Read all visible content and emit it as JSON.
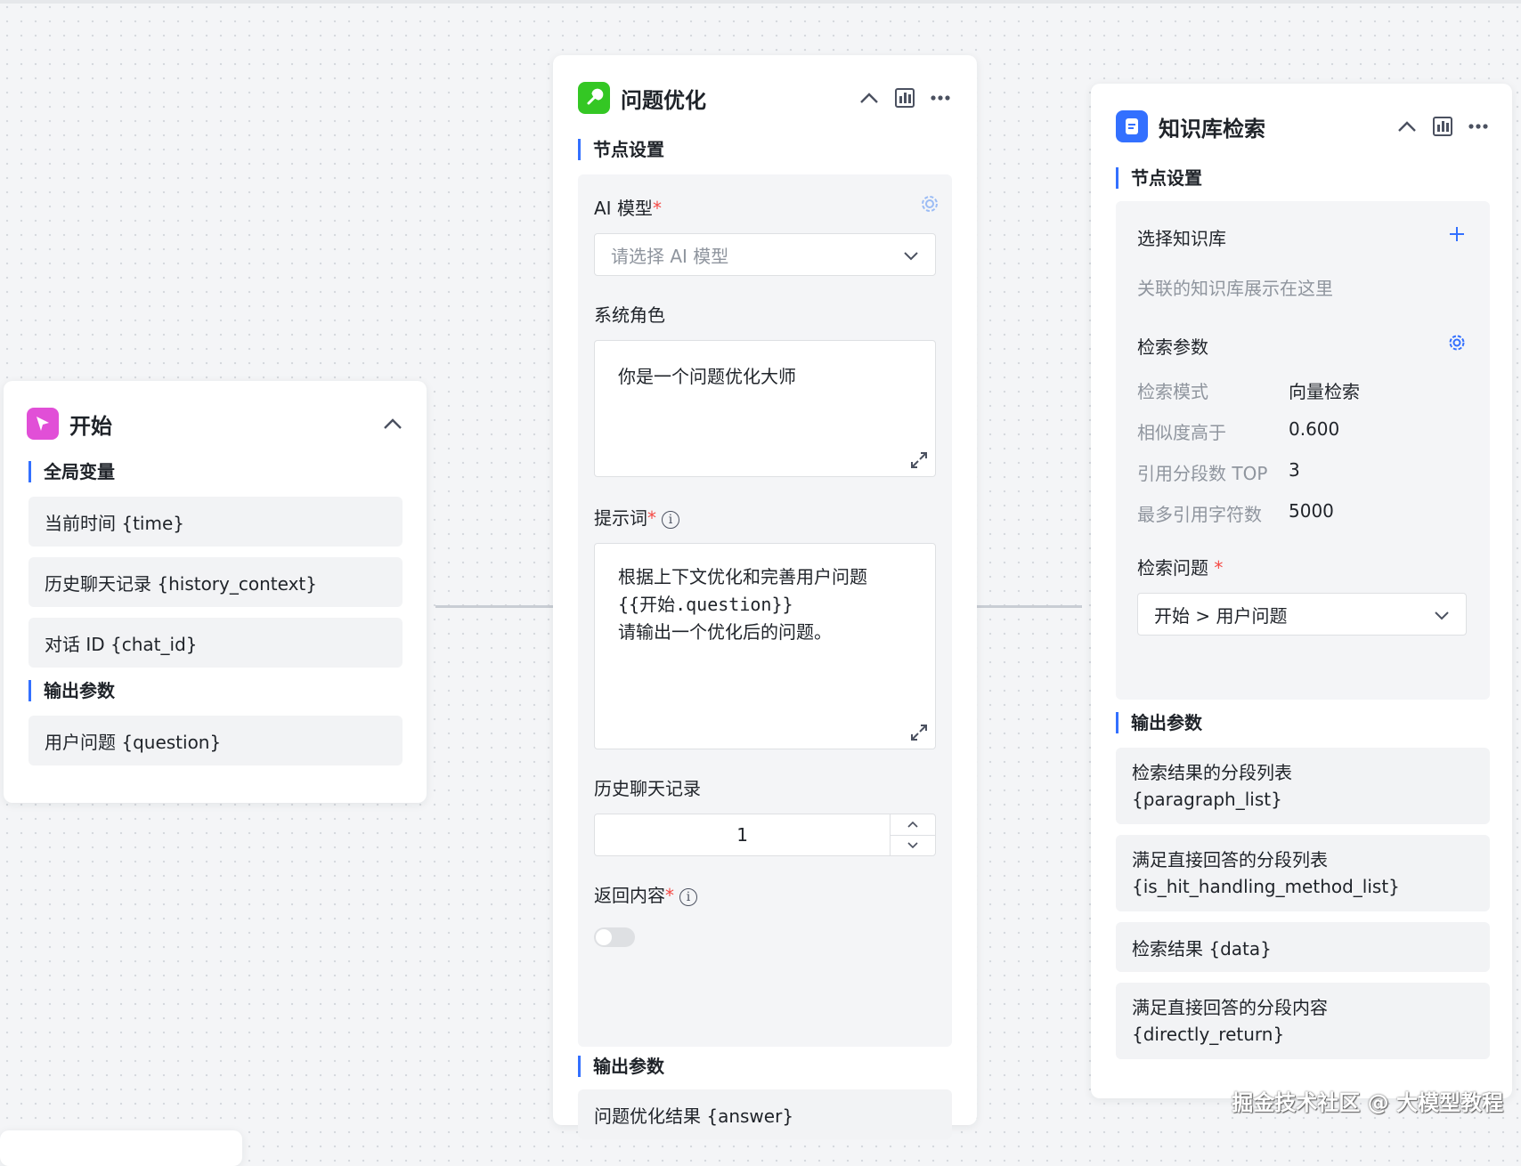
{
  "start_node": {
    "title": "开始",
    "global_vars_title": "全局变量",
    "global_vars": [
      "当前时间 {time}",
      "历史聊天记录 {history_context}",
      "对话 ID {chat_id}"
    ],
    "output_title": "输出参数",
    "outputs": [
      "用户问题 {question}"
    ]
  },
  "optimize_node": {
    "title": "问题优化",
    "settings_title": "节点设置",
    "ai_model_label": "AI 模型",
    "required_mark": "*",
    "ai_model_placeholder": "请选择 AI 模型",
    "system_role_label": "系统角色",
    "system_role_value": "你是一个问题优化大师",
    "prompt_label": "提示词",
    "prompt_lines": [
      "根据上下文优化和完善用户问题",
      "{{开始.question}}",
      "请输出一个优化后的问题。"
    ],
    "history_label": "历史聊天记录",
    "history_value": "1",
    "return_label": "返回内容",
    "return_enabled": false,
    "output_title": "输出参数",
    "outputs": [
      "问题优化结果 {answer}"
    ]
  },
  "kb_node": {
    "title": "知识库检索",
    "settings_title": "节点设置",
    "select_kb_label": "选择知识库",
    "kb_placeholder": "关联的知识库展示在这里",
    "params_label": "检索参数",
    "params": [
      {
        "label": "检索模式",
        "value": "向量检索"
      },
      {
        "label": "相似度高于",
        "value": "0.600"
      },
      {
        "label": "引用分段数 TOP",
        "value": "3"
      },
      {
        "label": "最多引用字符数",
        "value": "5000"
      }
    ],
    "question_label": "检索问题",
    "required_mark": "*",
    "question_value": "开始 > 用户问题",
    "output_title": "输出参数",
    "outputs": [
      {
        "line1": "检索结果的分段列表",
        "line2": "{paragraph_list}"
      },
      {
        "line1": "满足直接回答的分段列表",
        "line2": "{is_hit_handling_method_list}"
      },
      {
        "line1": "检索结果 {data}",
        "line2": ""
      },
      {
        "line1": "满足直接回答的分段内容",
        "line2": "{directly_return}"
      }
    ]
  },
  "watermark": "掘金技术社区 @ 大模型教程",
  "colors": {
    "start_icon": "#e14fd7",
    "optimize_icon": "#34c724",
    "kb_icon": "#3370ff",
    "accent": "#3370ff"
  }
}
